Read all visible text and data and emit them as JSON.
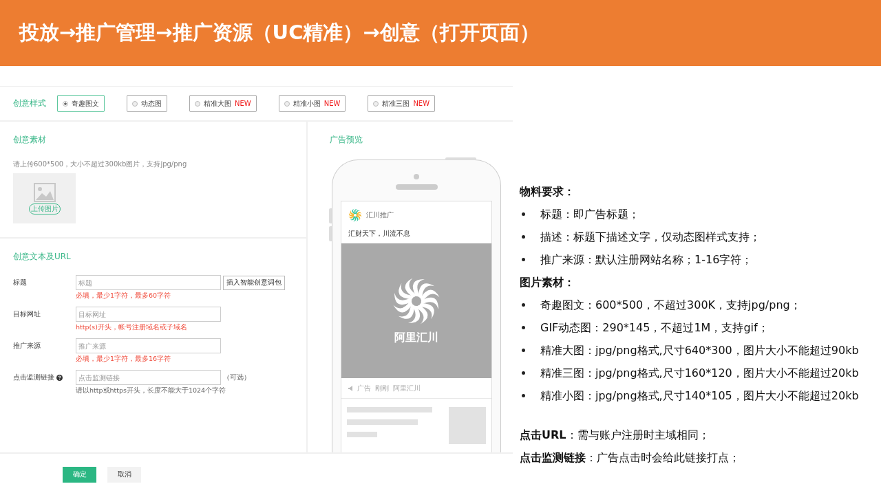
{
  "header": {
    "title": "投放→推广管理→推广资源（UC精准）→创意（打开页面）"
  },
  "style_row": {
    "label": "创意样式",
    "options": [
      {
        "label": "奇趣图文",
        "selected": true
      },
      {
        "label": "动态图",
        "selected": false
      },
      {
        "label": "精准大图",
        "badge": "NEW",
        "selected": false
      },
      {
        "label": "精准小图",
        "badge": "NEW",
        "selected": false
      },
      {
        "label": "精准三图",
        "badge": "NEW",
        "selected": false
      }
    ]
  },
  "material": {
    "title": "创意素材",
    "hint": "请上传600*500，大小不超过300kb图片，支持jpg/png",
    "upload_label": "上传图片"
  },
  "text_section": {
    "title": "创意文本及URL",
    "fields": [
      {
        "label": "标题",
        "placeholder": "标题",
        "hint": "必填，最少1字符，最多60字符",
        "error": true,
        "button": "插入智能创意词包"
      },
      {
        "label": "目标网址",
        "placeholder": "目标网址",
        "hint": "http(s)开头，帐号注册域名或子域名",
        "error": true
      },
      {
        "label": "推广来源",
        "placeholder": "推广来源",
        "hint": "必填，最少1字符，最多16字符",
        "error": true
      },
      {
        "label": "点击监测链接",
        "help": true,
        "placeholder": "点击监测链接",
        "suffix": "（可选）",
        "hint": "请以http或https开头，长度不能大于1024个字符",
        "error": false
      }
    ]
  },
  "preview": {
    "title": "广告预览",
    "account": "汇川推广",
    "headline": "汇财天下，川流不息",
    "image_text": "阿里汇川",
    "meta": [
      "广告",
      "刚刚",
      "阿里汇川"
    ]
  },
  "actions": [
    {
      "label": "确定",
      "kind": "primary"
    },
    {
      "label": "取消",
      "kind": "secondary"
    }
  ],
  "notes": [
    {
      "kind": "heading",
      "text": "物料要求："
    },
    {
      "kind": "bullet",
      "text": "标题：即广告标题；"
    },
    {
      "kind": "bullet",
      "text": "描述：标题下描述文字，仅动态图样式支持；"
    },
    {
      "kind": "bullet",
      "text": "推广来源：默认注册网站名称；1-16字符；"
    },
    {
      "kind": "heading",
      "text": "图片素材："
    },
    {
      "kind": "bullet",
      "text": "奇趣图文：600*500，不超过300K，支持jpg/png；"
    },
    {
      "kind": "bullet",
      "text": "GIF动态图：290*145，不超过1M，支持gif；"
    },
    {
      "kind": "bullet",
      "text": "精准大图：jpg/png格式,尺寸640*300，图片大小不能超过90kb"
    },
    {
      "kind": "bullet",
      "text": "精准三图：jpg/png格式,尺寸160*120，图片大小不能超过20kb"
    },
    {
      "kind": "bullet",
      "text": "精准小图：jpg/png格式,尺寸140*105，图片大小不能超过20kb"
    },
    {
      "kind": "line",
      "text": "**点击URL**：需与账户注册时主域相同；"
    },
    {
      "kind": "line",
      "text": "**点击监测链接**：广告点击时会给此链接打点；"
    }
  ]
}
